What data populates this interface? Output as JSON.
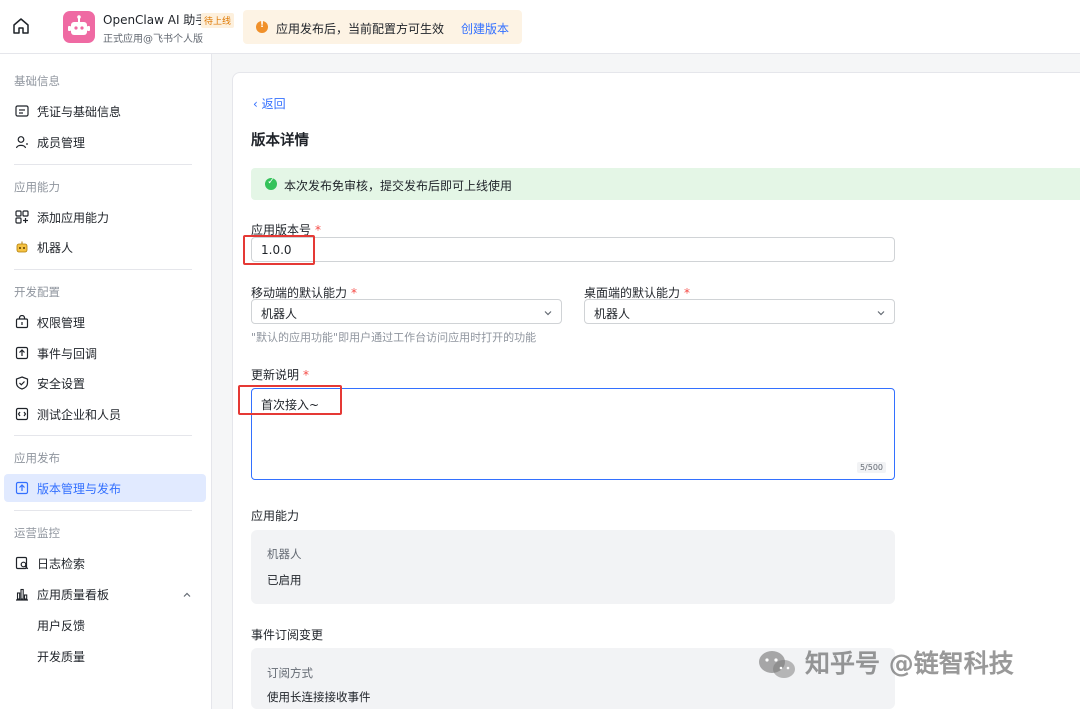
{
  "app": {
    "name": "OpenClaw AI 助手",
    "status_tag": "待上线",
    "subtitle": "正式应用@飞书个人版"
  },
  "notice": {
    "text": "应用发布后，当前配置方可生效",
    "link": "创建版本"
  },
  "sidebar": {
    "sections": [
      {
        "title": "基础信息",
        "items": [
          {
            "label": "凭证与基础信息",
            "icon": "credential-icon"
          },
          {
            "label": "成员管理",
            "icon": "member-icon"
          }
        ]
      },
      {
        "title": "应用能力",
        "items": [
          {
            "label": "添加应用能力",
            "icon": "add-capability-icon"
          },
          {
            "label": "机器人",
            "icon": "robot-icon"
          }
        ]
      },
      {
        "title": "开发配置",
        "items": [
          {
            "label": "权限管理",
            "icon": "permission-icon"
          },
          {
            "label": "事件与回调",
            "icon": "event-icon"
          },
          {
            "label": "安全设置",
            "icon": "shield-icon"
          },
          {
            "label": "测试企业和人员",
            "icon": "test-icon"
          }
        ]
      },
      {
        "title": "应用发布",
        "items": [
          {
            "label": "版本管理与发布",
            "icon": "version-icon",
            "active": true
          }
        ]
      },
      {
        "title": "运营监控",
        "items": [
          {
            "label": "日志检索",
            "icon": "log-icon"
          },
          {
            "label": "应用质量看板",
            "icon": "chart-icon"
          },
          {
            "label": "用户反馈"
          },
          {
            "label": "开发质量"
          }
        ]
      }
    ]
  },
  "main": {
    "back": "返回",
    "title": "版本详情",
    "success_msg": "本次发布免审核，提交发布后即可上线使用",
    "version_label": "应用版本号",
    "version_value": "1.0.0",
    "mobile_label": "移动端的默认能力",
    "mobile_value": "机器人",
    "desktop_label": "桌面端的默认能力",
    "desktop_value": "机器人",
    "hint": "\"默认的应用功能\"即用户通过工作台访问应用时打开的功能",
    "notes_label": "更新说明",
    "notes_value": "首次接入~",
    "notes_counter": "5/500",
    "capability_title": "应用能力",
    "capability_name": "机器人",
    "capability_status": "已启用",
    "event_title": "事件订阅变更",
    "event_key": "订阅方式",
    "event_value": "使用长连接接收事件",
    "required_mark": "*"
  },
  "watermark": "知乎号 @链智科技",
  "colors": {
    "accent": "#3370ff",
    "success": "#34c25a",
    "warning": "#f0902a",
    "highlight": "#e53935"
  }
}
